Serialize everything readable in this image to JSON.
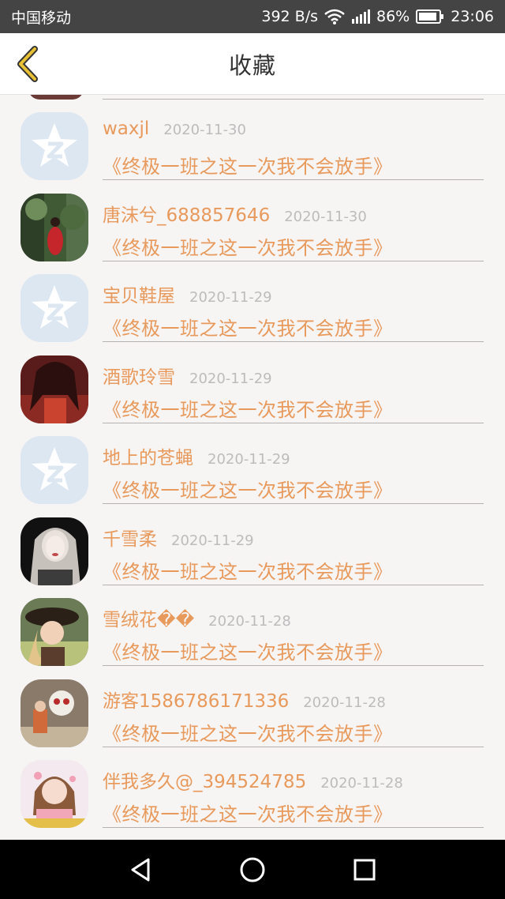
{
  "status_bar": {
    "carrier": "中国移动",
    "speed": "392 B/s",
    "battery": "86%",
    "time": "23:06"
  },
  "header": {
    "title": "收藏",
    "back_icon": "chevron-left-icon",
    "accent_color": "#e89a5c"
  },
  "items": [
    {
      "name": "waxjl",
      "date": "2020-11-30",
      "book": "《终极一班之这一次我不会放手》",
      "avatar": "default"
    },
    {
      "name": "唐沫兮_688857646",
      "date": "2020-11-30",
      "book": "《终极一班之这一次我不会放手》",
      "avatar": "photo-forest-red"
    },
    {
      "name": "宝贝鞋屋",
      "date": "2020-11-29",
      "book": "《终极一班之这一次我不会放手》",
      "avatar": "default"
    },
    {
      "name": "酒歌玲雪",
      "date": "2020-11-29",
      "book": "《终极一班之这一次我不会放手》",
      "avatar": "photo-anime-red"
    },
    {
      "name": "地上的苍蝇",
      "date": "2020-11-29",
      "book": "《终极一班之这一次我不会放手》",
      "avatar": "default"
    },
    {
      "name": "千雪柔",
      "date": "2020-11-29",
      "book": "《终极一班之这一次我不会放手》",
      "avatar": "photo-pale-girl"
    },
    {
      "name": "雪绒花��",
      "date": "2020-11-28",
      "book": "《终极一班之这一次我不会放手》",
      "avatar": "photo-child-hat"
    },
    {
      "name": "游客1586786171336",
      "date": "2020-11-28",
      "book": "《终极一班之这一次我不会放手》",
      "avatar": "photo-toys"
    },
    {
      "name": "伴我多久@_394524785",
      "date": "2020-11-28",
      "book": "《终极一班之这一次我不会放手》",
      "avatar": "photo-girl-pink"
    }
  ],
  "nav": {
    "back": "triangle-back-icon",
    "home": "circle-home-icon",
    "recents": "square-recents-icon"
  }
}
